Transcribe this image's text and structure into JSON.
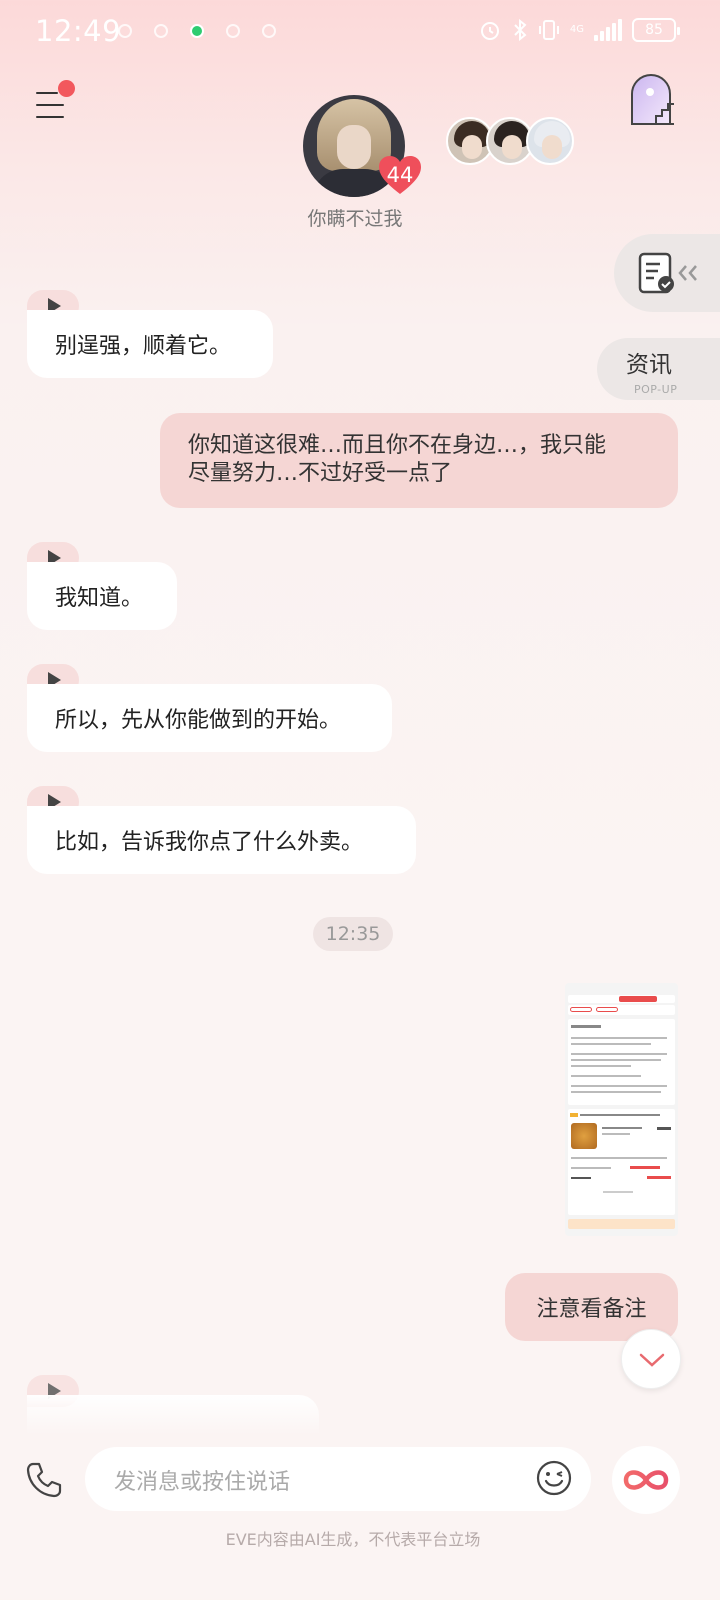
{
  "status_bar": {
    "time": "12:49",
    "battery": "85",
    "network": "4G"
  },
  "header": {
    "character_name": "你瞒不过我",
    "affinity_count": "44"
  },
  "side_panel": {
    "news_title": "资讯",
    "news_subtitle": "POP-UP"
  },
  "messages": [
    {
      "side": "left",
      "text": "别逞强，顺着它。",
      "voice": true
    },
    {
      "side": "right",
      "lines": [
        "你知道这很难…而且你不在身边…，我只能",
        "尽量努力…不过好受一点了"
      ]
    },
    {
      "side": "left",
      "text": "我知道。",
      "voice": true
    },
    {
      "side": "left",
      "text": "所以，先从你能做到的开始。",
      "voice": true
    },
    {
      "side": "left",
      "text": "比如，告诉我你点了什么外卖。",
      "voice": true
    },
    {
      "type": "timestamp",
      "text": "12:35"
    },
    {
      "side": "right",
      "type": "image",
      "alt": "order-screenshot"
    },
    {
      "side": "right",
      "text": "注意看备注"
    },
    {
      "side": "left",
      "voice": true,
      "partial": true
    }
  ],
  "input": {
    "placeholder": "发消息或按住说话"
  },
  "footer": {
    "disclaimer": "EVE内容由AI生成，不代表平台立场"
  },
  "icons": [
    "menu-icon",
    "window-icon",
    "play-icon",
    "document-check-icon",
    "phone-icon",
    "emoji-icon",
    "infinity-icon",
    "chevron-down-icon"
  ],
  "colors": {
    "accent": "#f2585d",
    "bubble_right": "#f5d6d4",
    "bubble_left": "#ffffff",
    "heart": "#ef4f5b"
  }
}
